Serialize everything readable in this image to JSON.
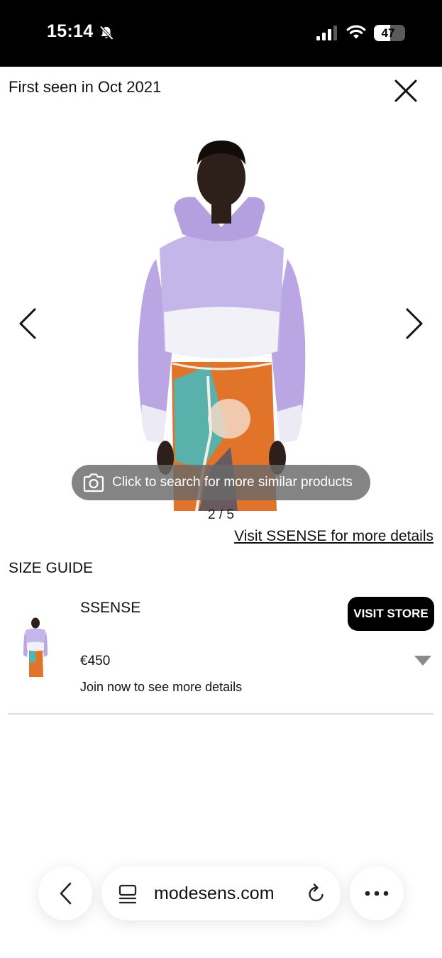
{
  "status_bar": {
    "time": "15:14",
    "battery": "47",
    "icons": [
      "bell-slash-icon",
      "cellular-signal-icon",
      "wifi-icon",
      "battery-icon"
    ]
  },
  "header": {
    "first_seen": "First seen in Oct 2021",
    "close_icon": "close-icon"
  },
  "gallery": {
    "pager": "2 / 5",
    "current_image": 2,
    "total_images": 5,
    "visual_search_label": "Click to search for more similar products",
    "icons": [
      "chevron-left-icon",
      "chevron-right-icon",
      "camera-icon"
    ]
  },
  "visit_link": "Visit SSENSE for more details",
  "size_guide": "SIZE GUIDE",
  "offer": {
    "store": "SSENSE",
    "visit_store_label": "VISIT STORE",
    "price": "€450",
    "note": "Join now to see more details",
    "expand_icon": "triangle-down-icon"
  },
  "browser_bar": {
    "url": "modesens.com",
    "icons": [
      "back-icon",
      "tabs-icon",
      "reload-icon",
      "more-icon"
    ]
  },
  "colors": {
    "status_bar_bg": "#000000",
    "button_bg": "#000000",
    "overlay_pill": "#696969",
    "hoodie_lavender": "#b9a6e3",
    "skirt_orange": "#e2742a",
    "skirt_teal": "#49b8b8"
  }
}
